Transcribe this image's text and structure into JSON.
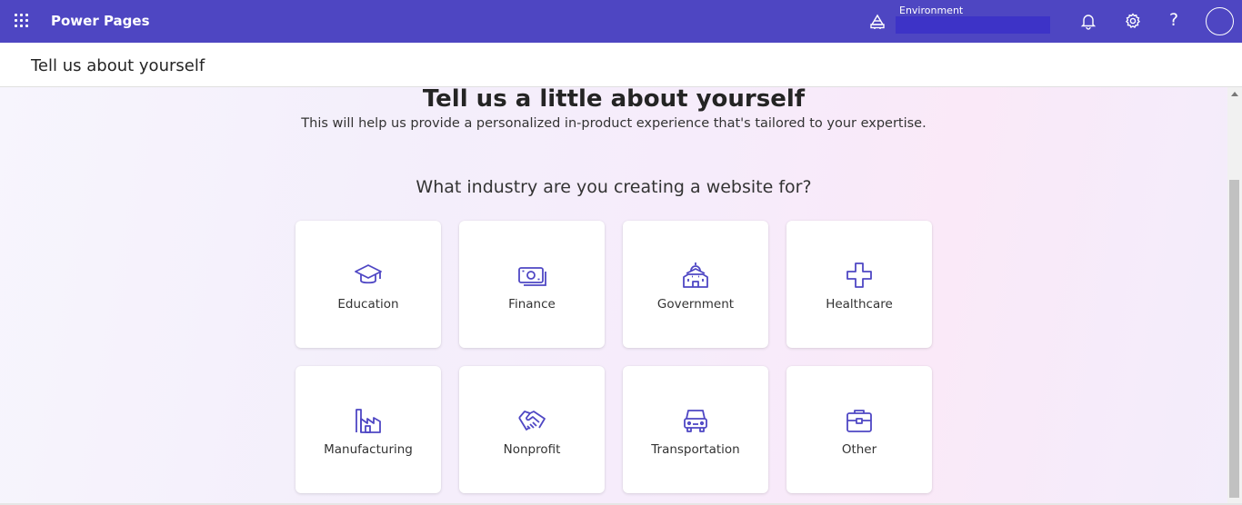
{
  "topbar": {
    "app_name": "Power Pages",
    "environment_label": "Environment",
    "environment_value": "",
    "help_glyph": "?",
    "bg_color": "#4e46c2",
    "icons": [
      "waffle-icon",
      "environment-icon",
      "bell-icon",
      "gear-icon",
      "help-icon",
      "avatar"
    ]
  },
  "subheader": {
    "title": "Tell us about yourself"
  },
  "main": {
    "heading": "Tell us a little about yourself",
    "subheading": "This will help us provide a personalized in-product experience that's tailored to your expertise.",
    "question": "What industry are you creating a website for?",
    "industries": [
      {
        "label": "Education",
        "icon": "graduation-cap-icon"
      },
      {
        "label": "Finance",
        "icon": "money-icon"
      },
      {
        "label": "Government",
        "icon": "building-government-icon"
      },
      {
        "label": "Healthcare",
        "icon": "health-cross-icon"
      },
      {
        "label": "Manufacturing",
        "icon": "factory-icon"
      },
      {
        "label": "Nonprofit",
        "icon": "handshake-icon"
      },
      {
        "label": "Transportation",
        "icon": "vehicle-car-icon"
      },
      {
        "label": "Other",
        "icon": "briefcase-icon"
      }
    ]
  },
  "colors": {
    "accent": "#4e46c2",
    "icon_stroke": "#4f47c4"
  }
}
